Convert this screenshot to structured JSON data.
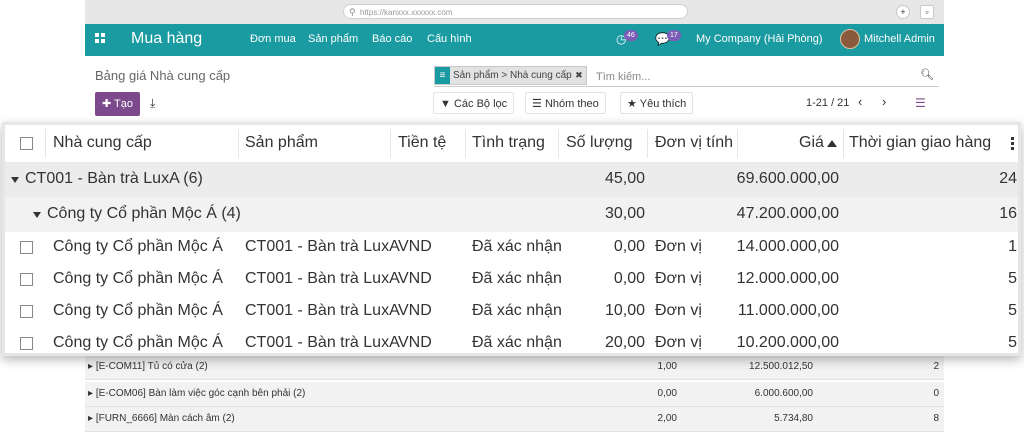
{
  "browser": {
    "url": "https://kanxxx.xxxxxx.com"
  },
  "navbar": {
    "app_title": "Mua hàng",
    "menu": [
      "Đơn mua",
      "Sản phẩm",
      "Báo cáo",
      "Cấu hình"
    ],
    "activity_count": "46",
    "message_count": "17",
    "company": "My Company (Hải Phòng)",
    "user": "Mitchell Admin"
  },
  "control": {
    "breadcrumb": "Bảng giá Nhà cung cấp",
    "facet": "Sản phẩm > Nhà cung cấp",
    "search_placeholder": "Tìm kiếm...",
    "create_label": "Tạo",
    "filters_label": "Các Bộ lọc",
    "groupby_label": "Nhóm theo",
    "favorites_label": "Yêu thích",
    "pager": "1-21 / 21"
  },
  "table": {
    "headers": {
      "vendor": "Nhà cung cấp",
      "product": "Sản phẩm",
      "currency": "Tiền tệ",
      "status": "Tình trạng",
      "qty": "Số lượng",
      "uom": "Đơn vị tính",
      "price": "Giá",
      "lead": "Thời gian giao hàng"
    },
    "group1": {
      "label": "CT001 - Bàn trà LuxA (6)",
      "qty": "45,00",
      "price": "69.600.000,00",
      "lead": "24"
    },
    "group2": {
      "label": "Công ty Cổ phần Mộc Á (4)",
      "qty": "30,00",
      "price": "47.200.000,00",
      "lead": "16"
    },
    "rows": [
      {
        "vendor": "Công ty Cổ phần Mộc Á",
        "product": "CT001 - Bàn trà LuxA",
        "currency": "VND",
        "status": "Đã xác nhận",
        "qty": "0,00",
        "uom": "Đơn vị",
        "price": "14.000.000,00",
        "lead": "1"
      },
      {
        "vendor": "Công ty Cổ phần Mộc Á",
        "product": "CT001 - Bàn trà LuxA",
        "currency": "VND",
        "status": "Đã xác nhận",
        "qty": "0,00",
        "uom": "Đơn vị",
        "price": "12.000.000,00",
        "lead": "5"
      },
      {
        "vendor": "Công ty Cổ phần Mộc Á",
        "product": "CT001 - Bàn trà LuxA",
        "currency": "VND",
        "status": "Đã xác nhận",
        "qty": "10,00",
        "uom": "Đơn vị",
        "price": "11.000.000,00",
        "lead": "5"
      },
      {
        "vendor": "Công ty Cổ phần Mộc Á",
        "product": "CT001 - Bàn trà LuxA",
        "currency": "VND",
        "status": "Đã xác nhận",
        "qty": "20,00",
        "uom": "Đơn vị",
        "price": "10.200.000,00",
        "lead": "5"
      }
    ]
  },
  "other_groups": [
    {
      "label": "[E-COM11] Tủ có cửa (2)",
      "qty": "1,00",
      "price": "12.500.012,50",
      "lead": "2"
    },
    {
      "label": "[E-COM06] Bàn làm việc góc cạnh bên phải (2)",
      "qty": "0,00",
      "price": "6.000.600,00",
      "lead": "0"
    },
    {
      "label": "[FURN_6666] Màn cách âm (2)",
      "qty": "2,00",
      "price": "5.734,80",
      "lead": "8"
    }
  ]
}
